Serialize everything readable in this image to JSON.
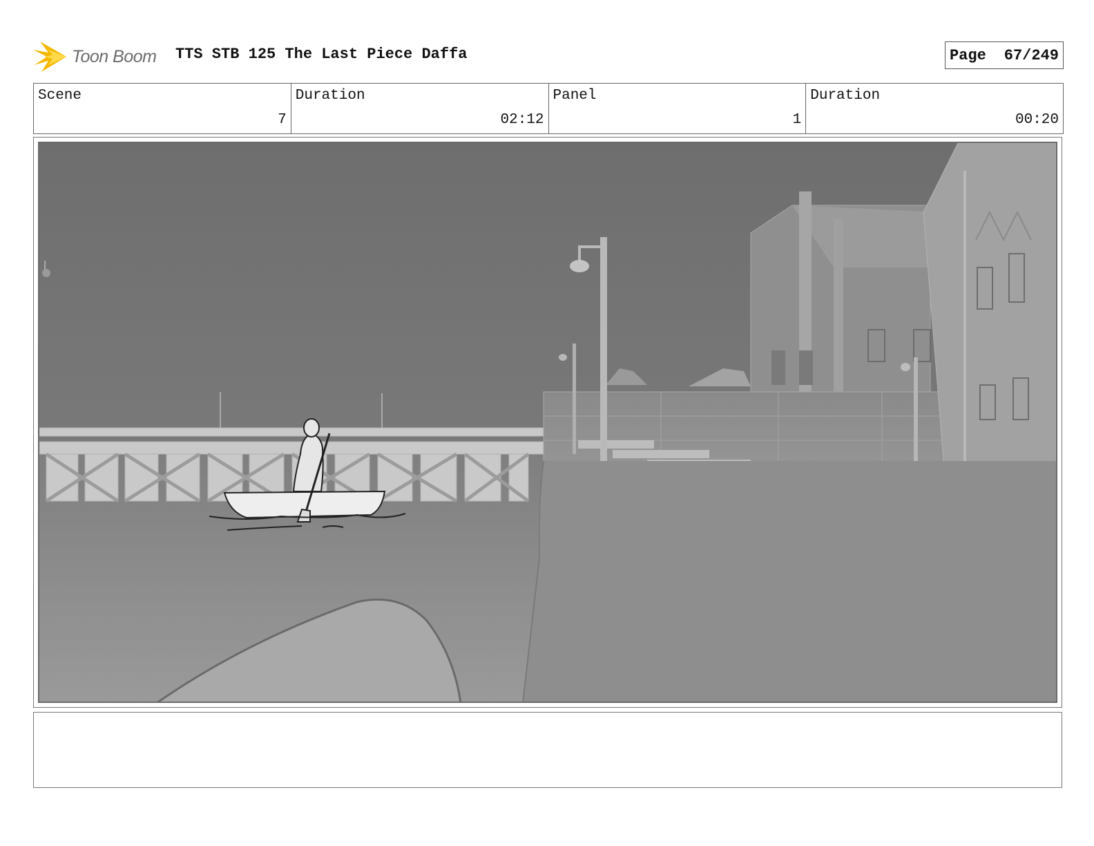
{
  "header": {
    "logo_text": "Toon Boom",
    "title": "TTS STB 125 The Last Piece Daffa",
    "page_label": "Page",
    "page_value": "67/249"
  },
  "info": {
    "scene_label": "Scene",
    "scene_value": "7",
    "scene_duration_label": "Duration",
    "scene_duration_value": "02:12",
    "panel_label": "Panel",
    "panel_value": "1",
    "panel_duration_label": "Duration",
    "panel_duration_value": "00:20"
  },
  "notes": {
    "text": ""
  },
  "colors": {
    "logo_accent": "#f5b800",
    "border": "#666666"
  }
}
